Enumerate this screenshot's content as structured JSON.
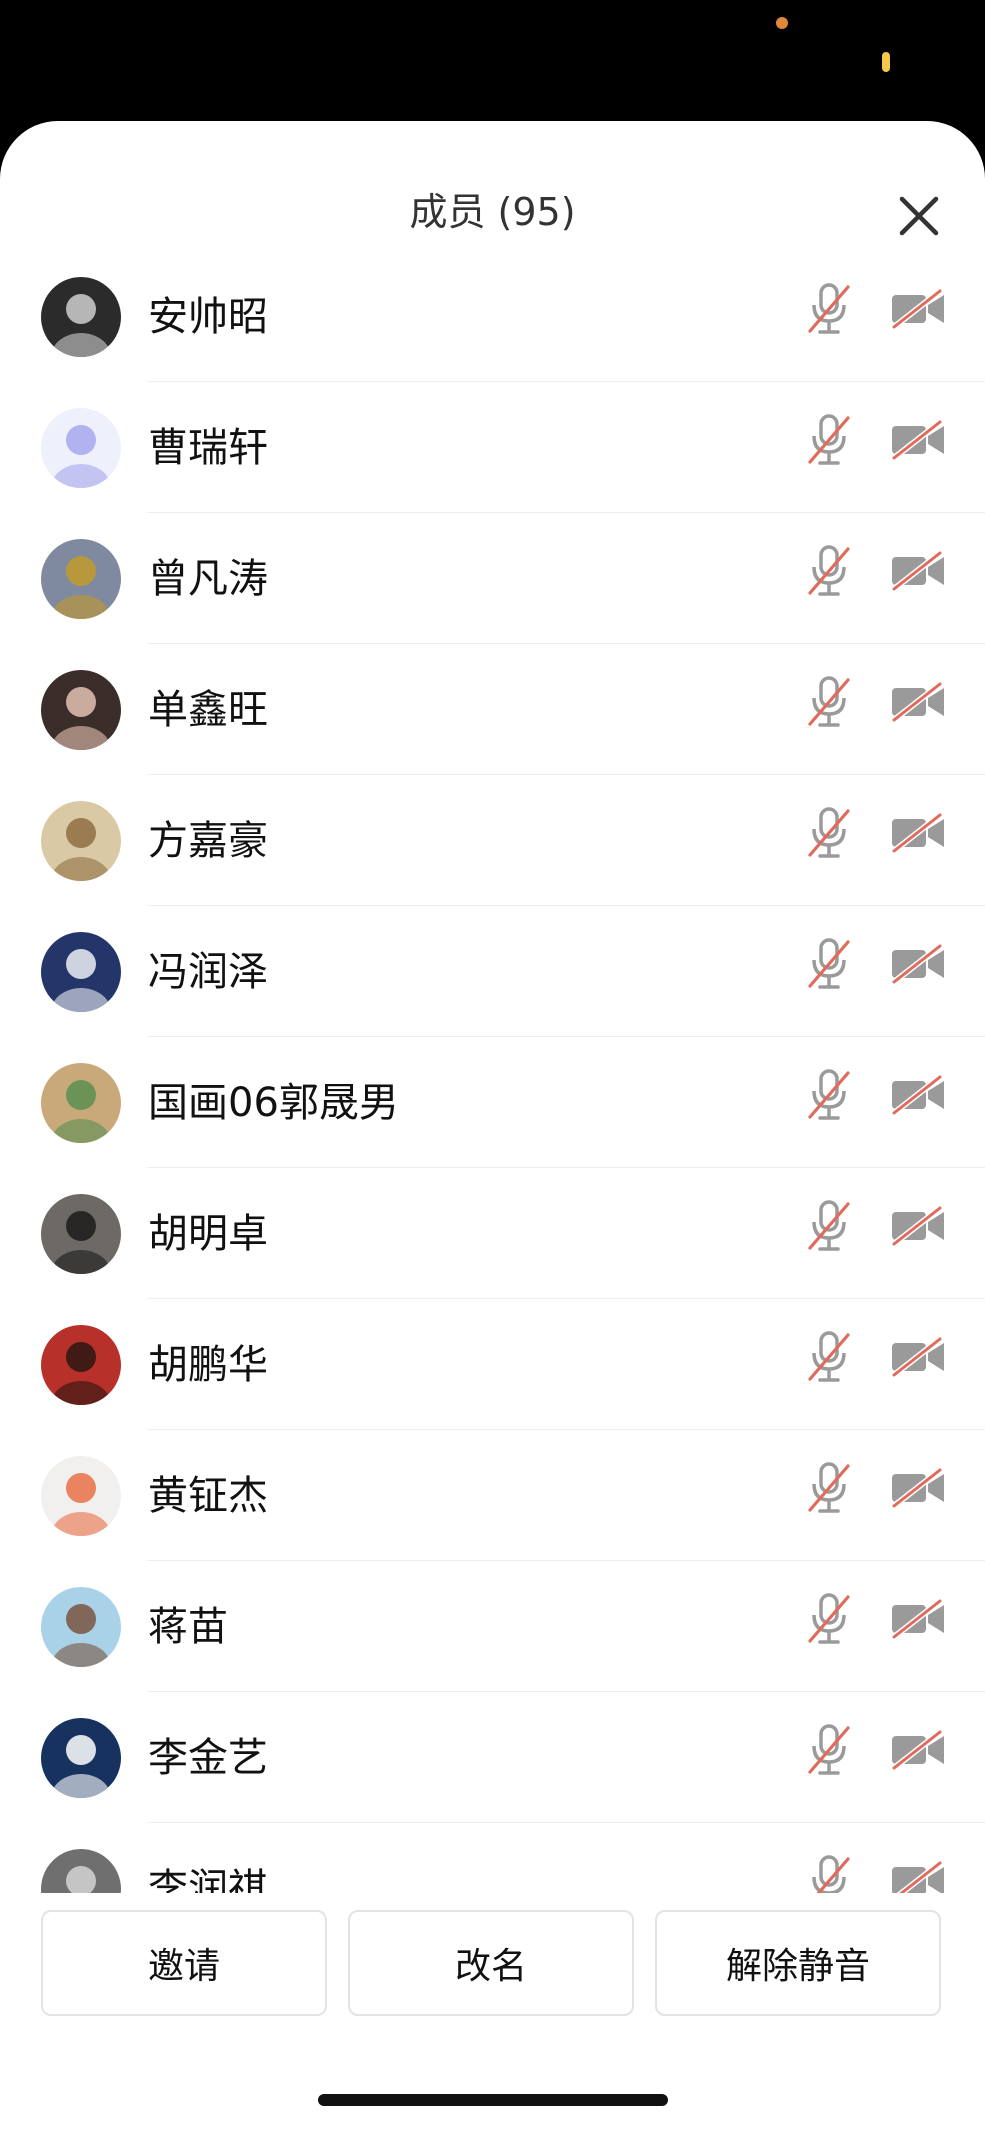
{
  "header": {
    "title": "成员 (95)",
    "close_icon": "close-icon"
  },
  "members": [
    {
      "name": "安帅昭",
      "avatar_bg": "#2b2b2b",
      "avatar_fg": "#cfcfcf"
    },
    {
      "name": "曹瑞轩",
      "avatar_bg": "#eef0fb",
      "avatar_fg": "#a8a7ef"
    },
    {
      "name": "曾凡涛",
      "avatar_bg": "#7f8aa0",
      "avatar_fg": "#c29a2a"
    },
    {
      "name": "单鑫旺",
      "avatar_bg": "#3a2d2a",
      "avatar_fg": "#e6c2b4"
    },
    {
      "name": "方嘉豪",
      "avatar_bg": "#d9c9a4",
      "avatar_fg": "#8f6f42"
    },
    {
      "name": "冯润泽",
      "avatar_bg": "#233569",
      "avatar_fg": "#eceff6"
    },
    {
      "name": "国画06郭晟男",
      "avatar_bg": "#c9a97a",
      "avatar_fg": "#5a8f52"
    },
    {
      "name": "胡明卓",
      "avatar_bg": "#6d6a66",
      "avatar_fg": "#1d1b1a"
    },
    {
      "name": "胡鹏华",
      "avatar_bg": "#b8302a",
      "avatar_fg": "#2a1612"
    },
    {
      "name": "黄钲杰",
      "avatar_bg": "#f2f0ee",
      "avatar_fg": "#e87046"
    },
    {
      "name": "蒋苗",
      "avatar_bg": "#a9d2e8",
      "avatar_fg": "#7a5540"
    },
    {
      "name": "李金艺",
      "avatar_bg": "#17325f",
      "avatar_fg": "#ffffff"
    },
    {
      "name": "李润祺",
      "avatar_bg": "#6f6f6f",
      "avatar_fg": "#d5d5d5"
    }
  ],
  "row_icons": {
    "mic": "mic-muted-icon",
    "camera": "camera-off-icon"
  },
  "actions": {
    "invite": "邀请",
    "rename": "改名",
    "unmute": "解除静音"
  },
  "colors": {
    "mute_slash": "#e06a5c",
    "icon_gray": "#9a9a9a"
  }
}
